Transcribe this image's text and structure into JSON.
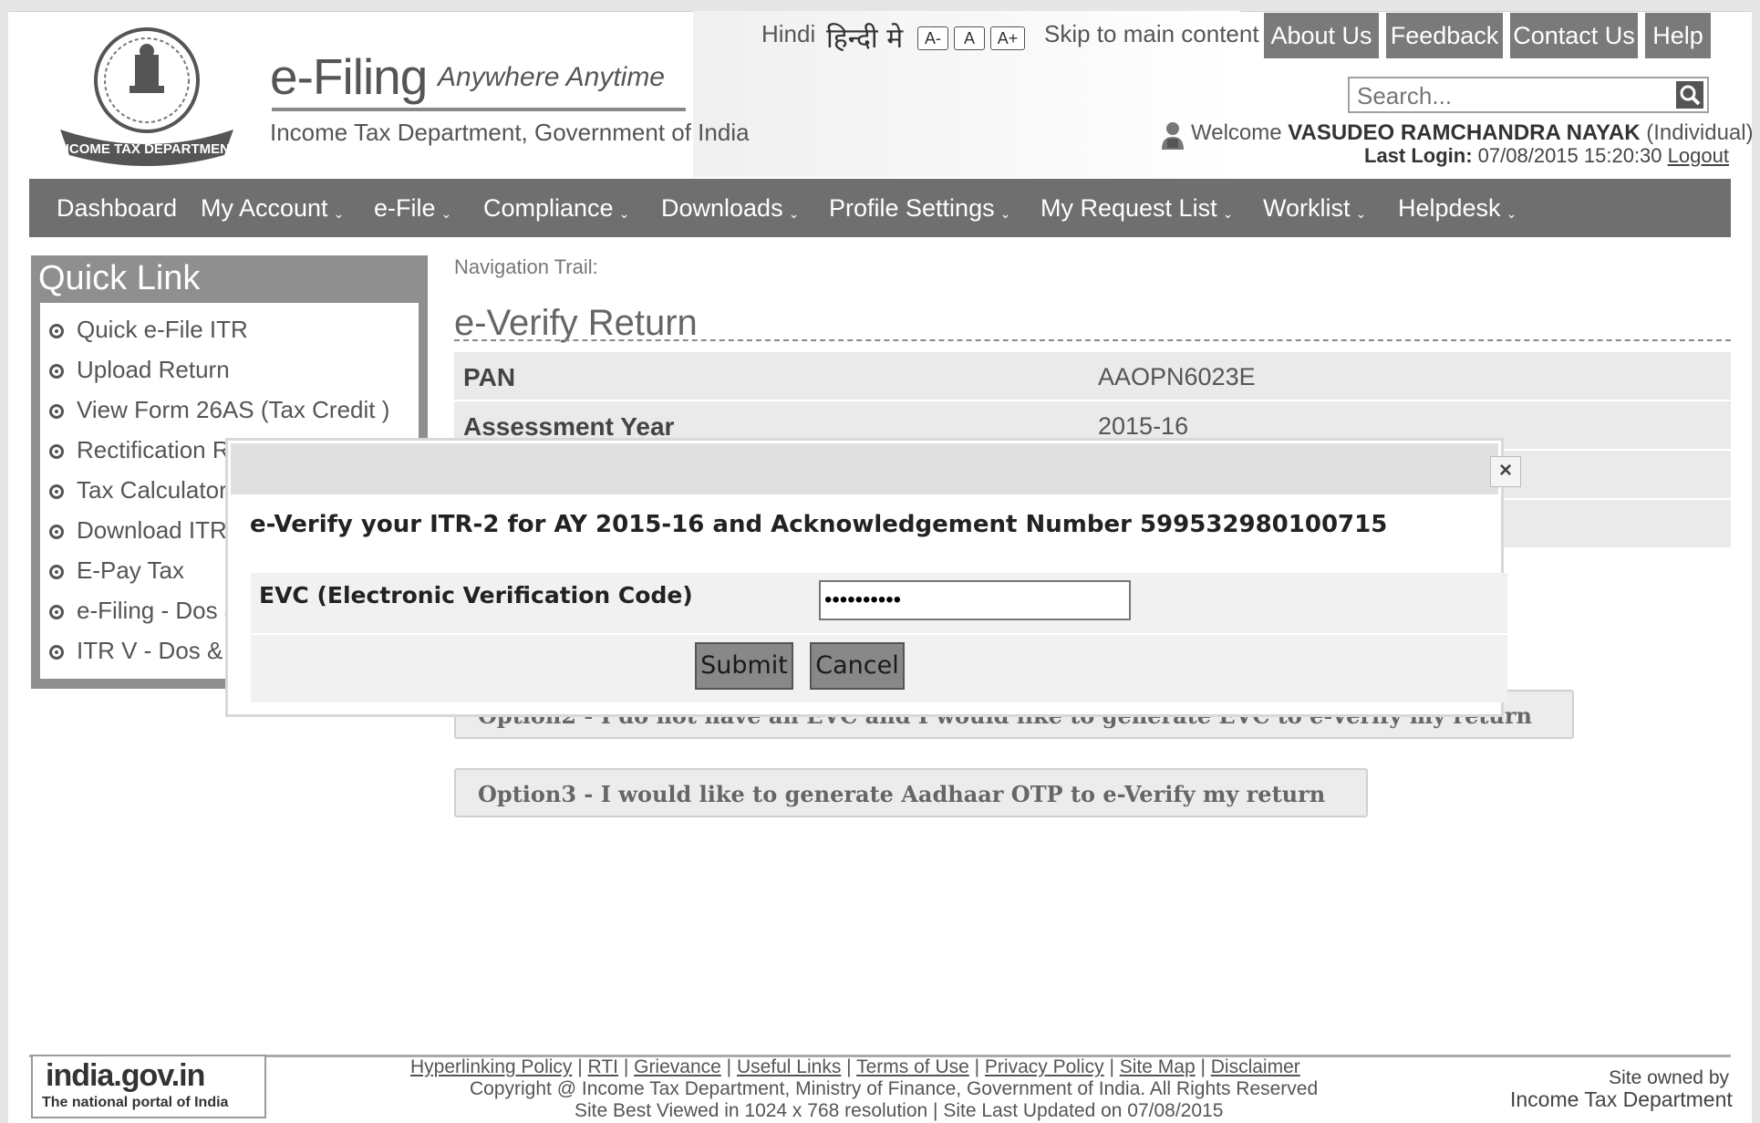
{
  "header": {
    "brand_title": "e-Filing",
    "brand_tagline": "Anywhere Anytime",
    "brand_subtitle": "Income Tax Department, Government of India",
    "emblem_text": "INCOME TAX DEPARTMENT"
  },
  "utility": {
    "hindi": "Hindi",
    "hindi_native": "हिन्दी मे",
    "font_decrease": "A-",
    "font_normal": "A",
    "font_increase": "A+",
    "skip": "Skip to main content",
    "about": "About Us",
    "feedback": "Feedback",
    "contact": "Contact Us",
    "help": "Help"
  },
  "search": {
    "placeholder": "Search..."
  },
  "user": {
    "welcome_prefix": "Welcome",
    "name": "VASUDEO RAMCHANDRA NAYAK",
    "type": "(Individual)",
    "last_login_label": "Last Login:",
    "last_login_value": "07/08/2015 15:20:30",
    "logout": "Logout"
  },
  "nav": {
    "dashboard": "Dashboard",
    "my_account": "My Account",
    "efile": "e-File",
    "compliance": "Compliance",
    "downloads": "Downloads",
    "profile": "Profile Settings",
    "requests": "My Request List",
    "worklist": "Worklist",
    "helpdesk": "Helpdesk"
  },
  "quick_link": {
    "title": "Quick Link",
    "items": [
      "Quick e-File ITR",
      "Upload Return",
      "View Form 26AS (Tax Credit )",
      "Rectification R",
      "Tax Calculator",
      "Download ITR",
      "E-Pay Tax",
      "e-Filing - Dos &",
      "ITR V - Dos &"
    ]
  },
  "main": {
    "navigation_trail": "Navigation Trail:",
    "title": "e-Verify Return",
    "rows": [
      {
        "label": "PAN",
        "value": "AAOPN6023E"
      },
      {
        "label": "Assessment Year",
        "value": "2015-16"
      }
    ],
    "option2": "Option2 - I do not have an EVC and I would like to generate EVC to e-Verify my return",
    "option3": "Option3 - I would like to generate Aadhaar OTP to e-Verify my return"
  },
  "modal": {
    "close": "×",
    "title": "e-Verify your ITR-2 for AY 2015-16 and Acknowledgement Number 599532980100715",
    "evc_label": "EVC (Electronic Verification Code)",
    "evc_value": "••••••••••",
    "submit": "Submit",
    "cancel": "Cancel"
  },
  "footer": {
    "links": [
      "Hyperlinking Policy",
      "RTI",
      "Grievance",
      "Useful Links",
      "Terms of Use",
      "Privacy Policy",
      "Site Map",
      "Disclaimer"
    ],
    "copyright": "Copyright @ Income Tax Department, Ministry of Finance, Government of India. All Rights Reserved",
    "best_viewed": "Site Best Viewed in 1024 x 768 resolution | Site Last Updated on 07/08/2015",
    "owned_by": "Site owned by",
    "owner": "Income Tax Department",
    "india_title": "india.gov.in",
    "india_sub": "The national portal of India"
  },
  "colors": {
    "nav_bg": "#6f6f6f",
    "top_button_bg": "#7a7a7a",
    "quick_link_bg": "#8f8f8f"
  }
}
